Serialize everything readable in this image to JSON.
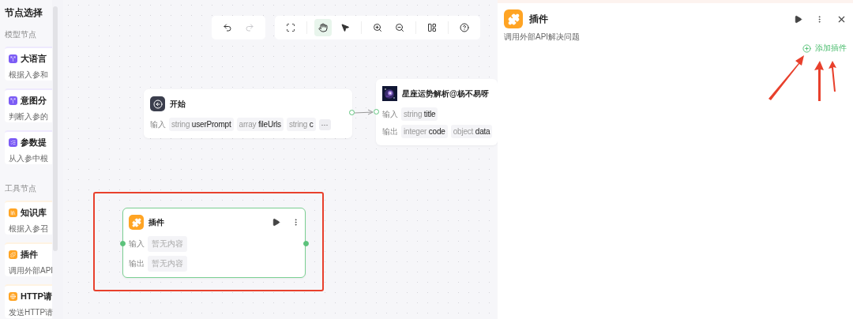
{
  "sidebar": {
    "title": "节点选择",
    "groups": [
      {
        "label": "模型节点",
        "items": [
          {
            "name": "大语言",
            "desc": "根据入参和",
            "color": "#7c5cf5"
          },
          {
            "name": "意图分",
            "desc": "判断入参的",
            "color": "#7c5cf5"
          },
          {
            "name": "参数提",
            "desc": "从入参中根",
            "color": "#7c5cf5"
          }
        ]
      },
      {
        "label": "工具节点",
        "items": [
          {
            "name": "知识库",
            "desc": "根据入参召",
            "color": "#ffa424"
          },
          {
            "name": "插件",
            "desc": "调用外部API",
            "color": "#ffa424"
          },
          {
            "name": "HTTP请",
            "desc": "发送HTTP请",
            "color": "#ffa424"
          }
        ]
      }
    ]
  },
  "toolbar": [
    [
      {
        "kind": "undo",
        "selected": false,
        "disabled": false
      },
      {
        "kind": "redo",
        "selected": false,
        "disabled": true
      }
    ],
    [
      {
        "kind": "fit",
        "selected": false,
        "disabled": false
      }
    ],
    [
      {
        "kind": "hand",
        "selected": true,
        "disabled": false
      },
      {
        "kind": "pointer",
        "selected": false,
        "disabled": false
      }
    ],
    [
      {
        "kind": "zoom_in",
        "selected": false,
        "disabled": false
      },
      {
        "kind": "zoom_out",
        "selected": false,
        "disabled": false
      }
    ],
    [
      {
        "kind": "layout",
        "selected": false,
        "disabled": false
      }
    ],
    [
      {
        "kind": "help",
        "selected": false,
        "disabled": false
      }
    ]
  ],
  "nodes": [
    {
      "kind": "start",
      "title": "开始",
      "rows": [
        {
          "label": "输入",
          "params": [
            {
              "type": "string",
              "name": "userPrompt"
            },
            {
              "type": "array",
              "name": "fileUrls"
            },
            {
              "type": "string",
              "name": "c"
            }
          ],
          "more": "···"
        }
      ]
    },
    {
      "kind": "plugin_call",
      "title": "星座运势解析@杨不易呀",
      "rows": [
        {
          "label": "输入",
          "params": [
            {
              "type": "string",
              "name": "title"
            }
          ]
        },
        {
          "label": "输出",
          "params": [
            {
              "type": "integer",
              "name": "code"
            },
            {
              "type": "object",
              "name": "data"
            }
          ]
        }
      ]
    },
    {
      "kind": "plugin",
      "title": "插件",
      "selected": true,
      "rows": [
        {
          "label": "输入",
          "empty": "暂无内容"
        },
        {
          "label": "输出",
          "empty": "暂无内容"
        }
      ]
    }
  ],
  "panel": {
    "title": "插件",
    "description": "调用外部API解决问题",
    "add_button": "添加插件"
  }
}
